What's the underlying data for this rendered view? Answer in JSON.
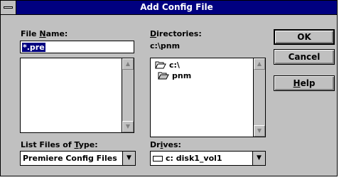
{
  "window": {
    "title": "Add Config File"
  },
  "file_name": {
    "label_pre": "File ",
    "label_key": "N",
    "label_post": "ame:",
    "value": "*.pre",
    "files": []
  },
  "directories": {
    "label_key": "D",
    "label_post": "irectories:",
    "current_path": "c:\\pnm",
    "items": [
      {
        "name": "c:\\",
        "icon": "open-folder-icon"
      },
      {
        "name": "pnm",
        "icon": "open-folder-icon"
      }
    ]
  },
  "file_type": {
    "label_pre": "List Files of ",
    "label_key": "T",
    "label_post": "ype:",
    "value": "Premiere Config Files"
  },
  "drives": {
    "label_pre": "Dr",
    "label_key": "i",
    "label_post": "ves:",
    "value": "c: disk1_vol1",
    "icon": "drive-icon"
  },
  "buttons": {
    "ok": "OK",
    "cancel": "Cancel",
    "help_key": "H",
    "help_post": "elp"
  },
  "icons": {
    "scroll_up": "▲",
    "scroll_down": "▼",
    "dropdown": "▼"
  }
}
